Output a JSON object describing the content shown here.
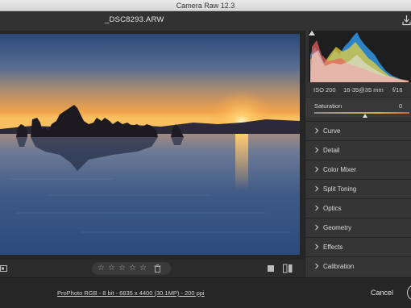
{
  "window": {
    "title": "Camera Raw 12.3"
  },
  "file": {
    "name": "_DSC8293.ARW"
  },
  "camera_info": {
    "iso": "ISO 200",
    "lens": "16-35@35 mm",
    "aperture": "f/16"
  },
  "saturation": {
    "label": "Saturation",
    "value": "0",
    "level": 0
  },
  "panels": [
    {
      "label": "Curve"
    },
    {
      "label": "Detail"
    },
    {
      "label": "Color Mixer"
    },
    {
      "label": "Split Toning"
    },
    {
      "label": "Optics"
    },
    {
      "label": "Geometry"
    },
    {
      "label": "Effects"
    },
    {
      "label": "Calibration"
    }
  ],
  "rating": {
    "stars": 0,
    "max": 5,
    "star_glyph": "☆"
  },
  "footer": {
    "workflow": "ProPhoto RGB - 8 bit - 6835 x 4400 (30.1MP) - 200 ppi",
    "cancel_label": "Cancel"
  },
  "icons": {
    "save": "save-icon",
    "zoom": "zoom-icon",
    "trash": "trash-icon",
    "view_single": "single-view-icon",
    "view_compare": "before-after-icon",
    "chevron": "chevron-right-icon"
  },
  "colors": {
    "panel_bg": "#353535",
    "sky_top": "#2c4a7a",
    "sunset": "#f5a040"
  }
}
